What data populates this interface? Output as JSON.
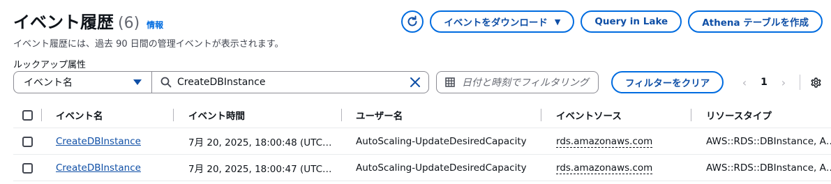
{
  "header": {
    "title": "イベント履歴",
    "count": "(6)",
    "info_link": "情報",
    "description": "イベント履歴には、過去 90 日間の管理イベントが表示されます。"
  },
  "actions": {
    "refresh_icon": "refresh-icon",
    "download_label": "イベントをダウンロード",
    "query_lake_label": "Query in Lake",
    "athena_label": "Athena テーブルを作成"
  },
  "filter": {
    "lookup_label": "ルックアップ属性",
    "attribute_value": "イベント名",
    "search_value": "CreateDBInstance",
    "date_placeholder": "日付と時刻でフィルタリング",
    "clear_label": "フィルターをクリア"
  },
  "pagination": {
    "current_page": "1"
  },
  "table": {
    "columns": [
      "イベント名",
      "イベント時間",
      "ユーザー名",
      "イベントソース",
      "リソースタイプ"
    ],
    "rows": [
      {
        "event_name": "CreateDBInstance",
        "event_time": "7月 20, 2025, 18:00:48 (UTC…",
        "user_name": "AutoScaling-UpdateDesiredCapacity",
        "event_source": "rds.amazonaws.com",
        "resource_type": "AWS::RDS::DBInstance, A…"
      },
      {
        "event_name": "CreateDBInstance",
        "event_time": "7月 20, 2025, 18:00:47 (UTC…",
        "user_name": "AutoScaling-UpdateDesiredCapacity",
        "event_source": "rds.amazonaws.com",
        "resource_type": "AWS::RDS::DBInstance, A…"
      }
    ]
  },
  "colors": {
    "link": "#0f4fa6",
    "button_border": "#006ce0",
    "text": "#0f141a",
    "secondary_text": "#656871"
  }
}
